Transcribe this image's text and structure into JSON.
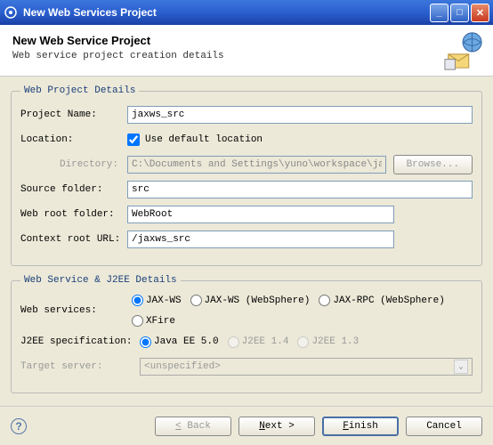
{
  "window": {
    "title": "New Web Services Project"
  },
  "header": {
    "title": "New Web Service Project",
    "subtitle": "Web service project creation details"
  },
  "fieldset1": {
    "legend": "Web Project Details",
    "projectName": {
      "label": "Project Name:",
      "value": "jaxws_src"
    },
    "location": {
      "label": "Location:",
      "checkbox": "Use default location"
    },
    "directory": {
      "label": "Directory:",
      "value": "C:\\Documents and Settings\\yuno\\workspace\\jaxws_src",
      "browse": "Browse..."
    },
    "sourceFolder": {
      "label": "Source folder:",
      "value": "src"
    },
    "webRoot": {
      "label": "Web root folder:",
      "value": "WebRoot"
    },
    "contextRoot": {
      "label": "Context root URL:",
      "value": "/jaxws_src"
    }
  },
  "fieldset2": {
    "legend": "Web Service & J2EE Details",
    "webServices": {
      "label": "Web services:",
      "options": [
        "JAX-WS",
        "JAX-WS (WebSphere)",
        "JAX-RPC (WebSphere)",
        "XFire"
      ]
    },
    "j2ee": {
      "label": "J2EE specification:",
      "options": [
        "Java EE 5.0",
        "J2EE 1.4",
        "J2EE 1.3"
      ]
    },
    "targetServer": {
      "label": "Target server:",
      "value": "<unspecified>"
    }
  },
  "footer": {
    "back": "< Back",
    "next": "Next >",
    "finish": "Finish",
    "cancel": "Cancel"
  }
}
